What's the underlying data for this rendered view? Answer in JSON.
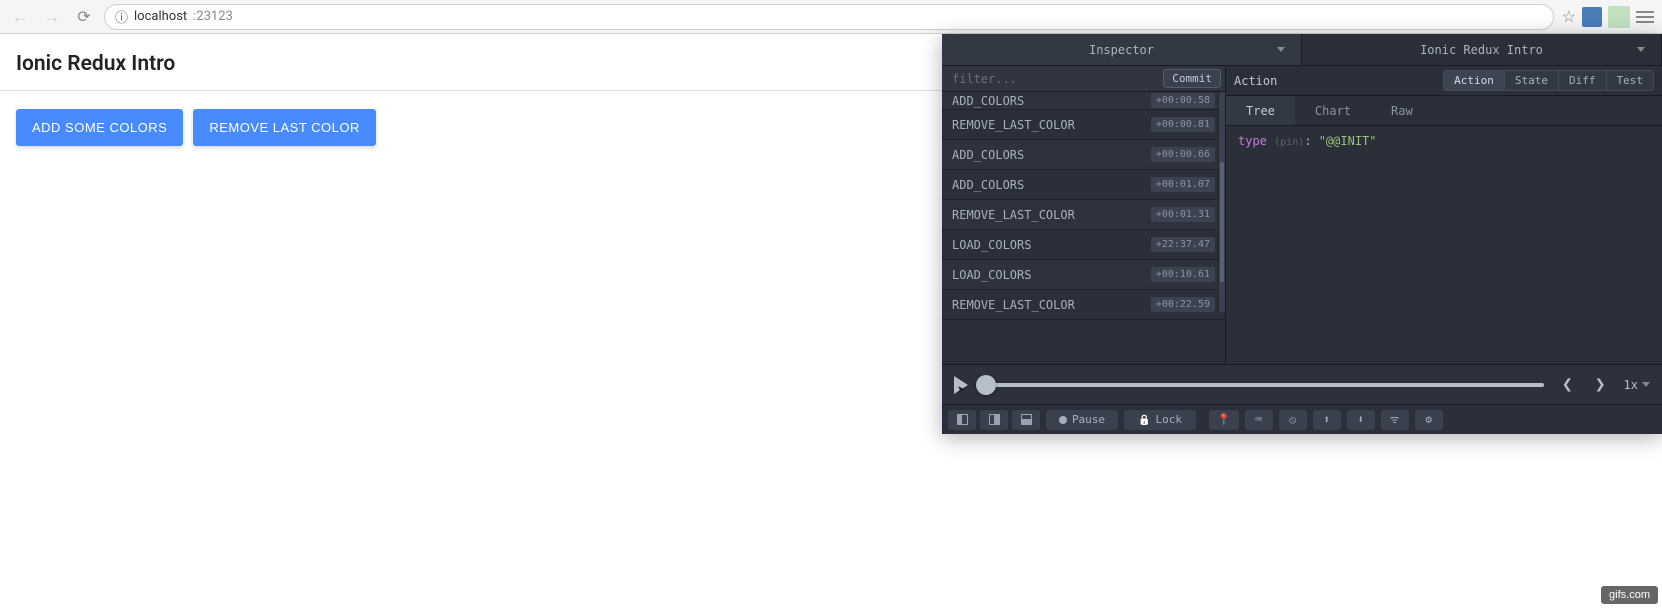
{
  "browser": {
    "url_host": "localhost",
    "url_port": ":23123"
  },
  "page": {
    "title": "Ionic Redux Intro",
    "buttons": {
      "add": "ADD SOME COLORS",
      "remove": "REMOVE LAST COLOR"
    }
  },
  "devtools": {
    "tabs": {
      "inspector": "Inspector",
      "instance": "Ionic Redux Intro"
    },
    "filter_placeholder": "filter...",
    "commit": "Commit",
    "actions": [
      {
        "name": "ADD_COLORS",
        "time": "+00:00.58"
      },
      {
        "name": "REMOVE_LAST_COLOR",
        "time": "+00:00.81"
      },
      {
        "name": "ADD_COLORS",
        "time": "+00:00.66"
      },
      {
        "name": "ADD_COLORS",
        "time": "+00:01.07"
      },
      {
        "name": "REMOVE_LAST_COLOR",
        "time": "+00:01.31"
      },
      {
        "name": "LOAD_COLORS",
        "time": "+22:37.47"
      },
      {
        "name": "LOAD_COLORS",
        "time": "+00:10.61"
      },
      {
        "name": "REMOVE_LAST_COLOR",
        "time": "+00:22.59"
      }
    ],
    "inspector": {
      "title": "Action",
      "views": {
        "action": "Action",
        "state": "State",
        "diff": "Diff",
        "test": "Test"
      },
      "formats": {
        "tree": "Tree",
        "chart": "Chart",
        "raw": "Raw"
      },
      "tree": {
        "key": "type",
        "pin": "(pin)",
        "value": "\"@@INIT\""
      }
    },
    "player": {
      "speed": "1x"
    },
    "bottombar": {
      "pause": "Pause",
      "lock": "Lock"
    }
  },
  "watermark": "gifs.com"
}
